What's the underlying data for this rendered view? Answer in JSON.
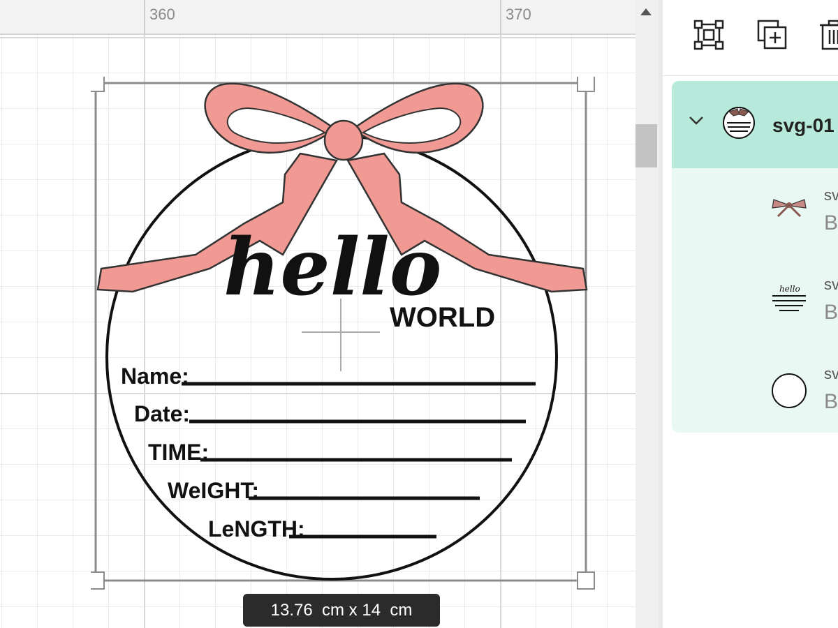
{
  "ruler": {
    "labels": [
      "360",
      "370"
    ]
  },
  "canvas": {
    "hello_text": "hello",
    "world_text": "WORLD",
    "fields": [
      "Name:",
      "Date:",
      "TIME:",
      "WeIGHT:",
      "LeNGTH:"
    ],
    "selection_size": "13.76  cm x 14  cm",
    "bow_color": "#f09a93"
  },
  "toolbar": {
    "icons": [
      "group-icon",
      "duplicate-icon",
      "delete-icon"
    ]
  },
  "layers": {
    "group_name": "svg-01",
    "items": [
      {
        "name": "svg",
        "sub": "Ba",
        "icon": "bow-icon"
      },
      {
        "name": "svg",
        "sub": "Ba",
        "icon": "lines-icon"
      },
      {
        "name": "svg",
        "sub": "Ba",
        "icon": "circle-icon"
      }
    ],
    "accent": "#b8eadb",
    "children_bg": "#e9f8f2"
  }
}
